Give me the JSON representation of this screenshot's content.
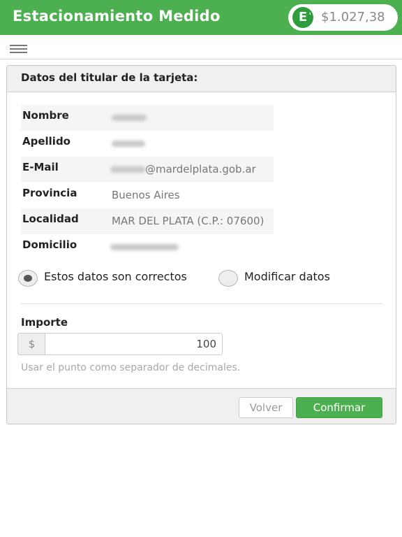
{
  "header": {
    "title": "Estacionamiento Medido",
    "badge_letter": "E",
    "badge_mark": "'",
    "balance": "$1.027,38"
  },
  "panel": {
    "title": "Datos del titular de la tarjeta:",
    "fields": [
      {
        "label": "Nombre",
        "value": ""
      },
      {
        "label": "Apellido",
        "value": ""
      },
      {
        "label": "E-Mail",
        "value": "@mardelplata.gob.ar"
      },
      {
        "label": "Provincia",
        "value": "Buenos Aires"
      },
      {
        "label": "Localidad",
        "value": "MAR DEL PLATA (C.P.: 07600)"
      },
      {
        "label": "Domicilio",
        "value": ""
      }
    ],
    "options": [
      {
        "label": "Estos datos son correctos",
        "selected": true
      },
      {
        "label": "Modificar datos",
        "selected": false
      }
    ],
    "amount": {
      "label": "Importe",
      "currency": "$",
      "value": "100",
      "help": "Usar el punto como separador de decimales."
    },
    "buttons": {
      "back": "Volver",
      "confirm": "Confirmar"
    }
  },
  "colors": {
    "brand": "#4caf50",
    "badge": "#2e9d3e"
  }
}
